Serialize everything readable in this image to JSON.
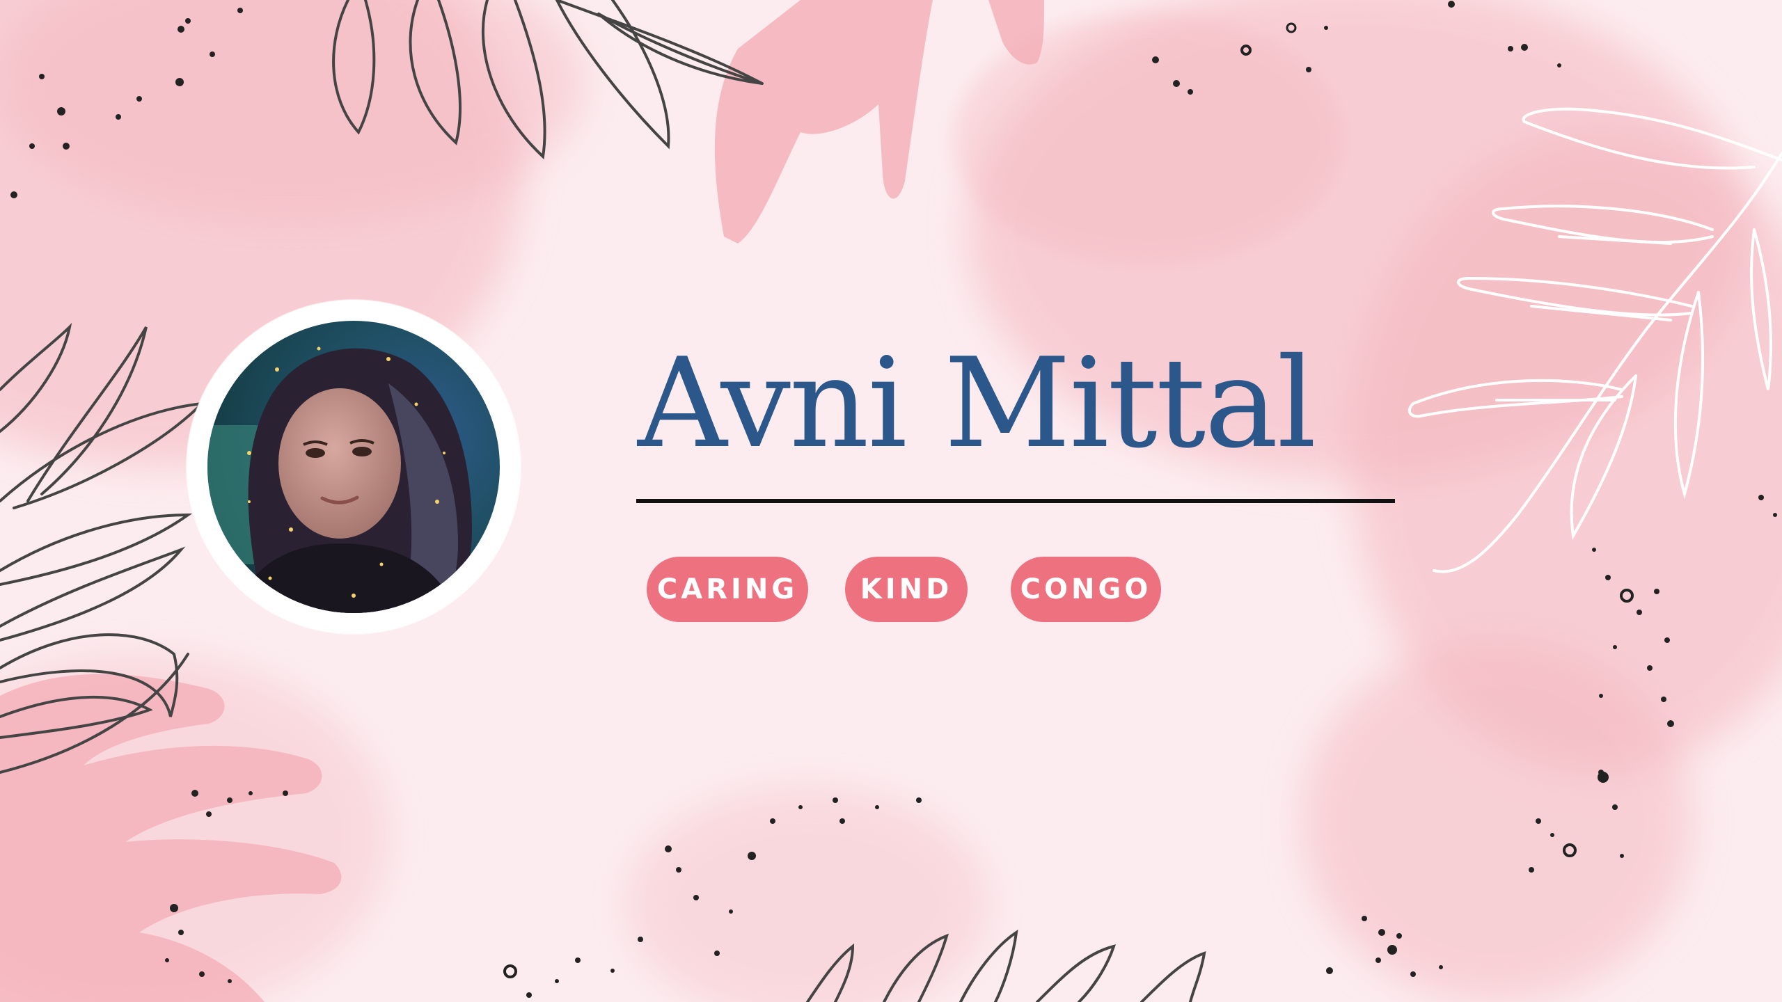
{
  "profile": {
    "name": "Avni Mittal",
    "tags": [
      "CARING",
      "KIND",
      "CONGO"
    ]
  },
  "colors": {
    "background": "#fcecef",
    "watercolor": "#f4b5bd",
    "name": "#2b578a",
    "tag": "#ee7180",
    "line_art": "#444444",
    "white_leaves": "#ffffff"
  },
  "decorations": {
    "leaf_outline_icons": [
      "leaf-branch-top",
      "leaf-branch-left",
      "leaf-branch-bottom"
    ],
    "white_leaf_icon": "leaf-branch-right",
    "hand_silhouette_icons": [
      "hand-top",
      "hand-bottom-left"
    ]
  }
}
